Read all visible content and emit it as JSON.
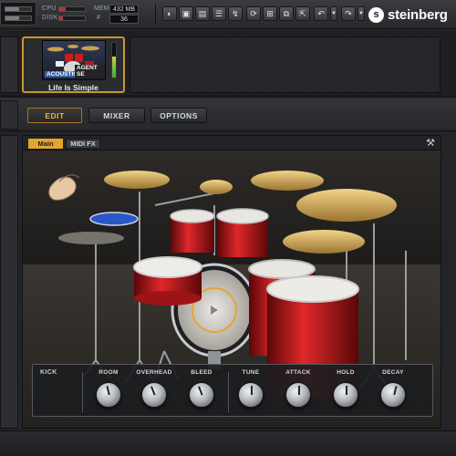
{
  "toolbar": {
    "cpu_label": "CPU",
    "disk_label": "DISK",
    "mem_label": "MEM",
    "mem_value": "432 MB",
    "hash_label": "#",
    "voices_value": "36",
    "cpu_load": 0.25,
    "disk_load": 0.15,
    "buttons": [
      "cut-icon",
      "image-icon",
      "edit-icon",
      "settings-icon",
      "bolt-icon",
      "loop-icon",
      "grid-icon",
      "layers-icon",
      "export-icon",
      "undo-icon",
      "undo-menu-icon",
      "redo-icon",
      "redo-menu-icon"
    ],
    "brand_name": "steinberg"
  },
  "preset": {
    "name": "Life Is Simple",
    "badge_acoustic": "ACOUSTIC",
    "badge_agent": "AGENT SE",
    "level": 0.6
  },
  "tabs": {
    "edit": "EDIT",
    "mixer": "MIXER",
    "options": "OPTIONS",
    "active": "EDIT"
  },
  "panel": {
    "tab_main": "Main",
    "tab_midi": "MIDI FX"
  },
  "mixer": {
    "title": "KICK",
    "knobs": [
      {
        "label": "ROOM",
        "value": 0.45
      },
      {
        "label": "OVERHEAD",
        "value": 0.42
      },
      {
        "label": "BLEED",
        "value": 0.42
      },
      {
        "label": "TUNE",
        "value": 0.5
      },
      {
        "label": "ATTACK",
        "value": 0.5
      },
      {
        "label": "HOLD",
        "value": 0.5
      },
      {
        "label": "DECAY",
        "value": 0.55
      }
    ]
  },
  "colors": {
    "accent": "#e4a52f",
    "drum_red": "#c8191c",
    "brand": "#ffffff"
  }
}
